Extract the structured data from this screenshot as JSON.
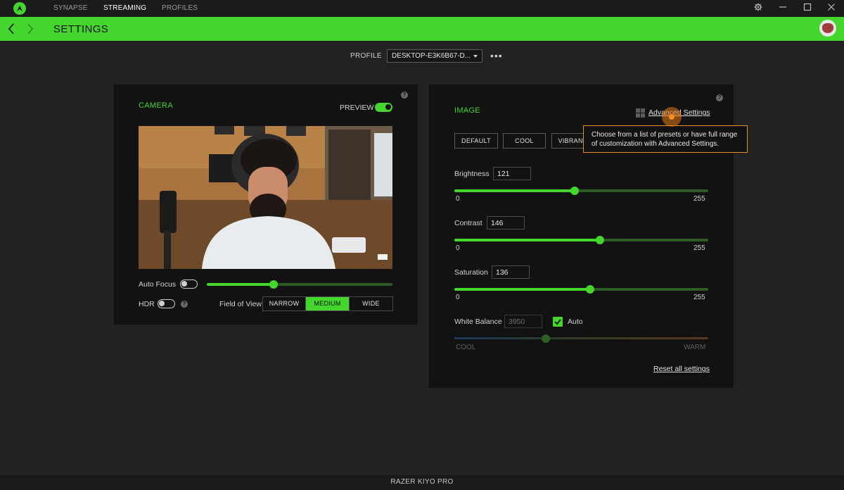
{
  "nav": {
    "tabs": [
      {
        "label": "SYNAPSE",
        "active": false
      },
      {
        "label": "STREAMING",
        "active": true
      },
      {
        "label": "PROFILES",
        "active": false
      }
    ]
  },
  "header": {
    "title": "SETTINGS"
  },
  "profile": {
    "label": "PROFILE",
    "selected": "DESKTOP-E3K6B67-D..."
  },
  "camera": {
    "title": "CAMERA",
    "preview_label": "PREVIEW",
    "preview_on": true,
    "auto_focus_label": "Auto Focus",
    "auto_focus_on": false,
    "focus_level": 0.36,
    "hdr_label": "HDR",
    "hdr_on": false,
    "fov_label": "Field of View",
    "fov_options": [
      "NARROW",
      "MEDIUM",
      "WIDE"
    ],
    "fov_selected": "MEDIUM"
  },
  "image": {
    "title": "IMAGE",
    "advanced_settings": "Advanced Settings",
    "presets": [
      "DEFAULT",
      "COOL",
      "VIBRANT"
    ],
    "tooltip": {
      "line1": "Choose from a list of presets or have full range",
      "line2": "of customization with Advanced Settings."
    },
    "brightness": {
      "label": "Brightness",
      "value": 121,
      "min": 0,
      "max": 255
    },
    "contrast": {
      "label": "Contrast",
      "value": 146,
      "min": 0,
      "max": 255
    },
    "saturation": {
      "label": "Saturation",
      "value": 136,
      "min": 0,
      "max": 255
    },
    "white_balance": {
      "label": "White Balance",
      "value": "3950",
      "auto_label": "Auto",
      "auto_checked": true,
      "cool_label": "COOL",
      "warm_label": "WARM",
      "level": 0.36
    },
    "reset_label": "Reset all settings"
  },
  "status": {
    "device": "RAZER KIYO PRO"
  },
  "colors": {
    "accent": "#44d62c",
    "tooltip_border": "#e6902a",
    "panel": "#121212",
    "background": "#222222"
  }
}
